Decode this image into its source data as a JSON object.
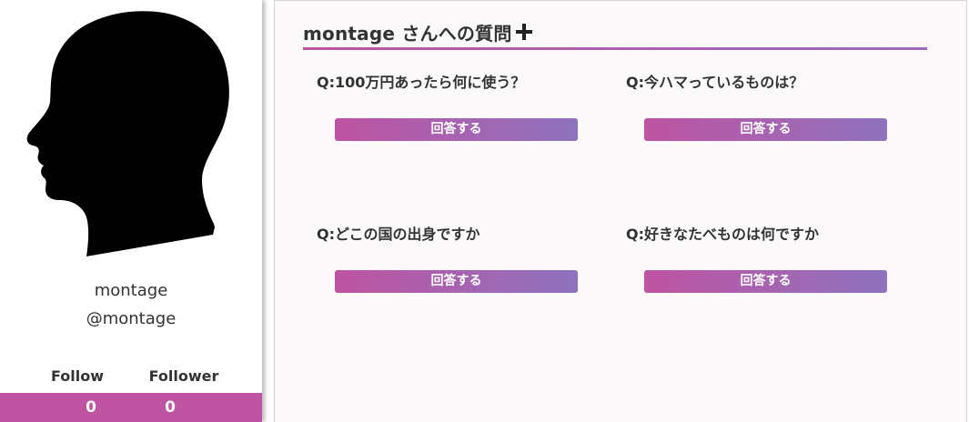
{
  "profile": {
    "name": "montage",
    "handle": "@montage",
    "follow_label": "Follow",
    "follower_label": "Follower",
    "follow_count": "0",
    "follower_count": "0",
    "accent_color": "#bf54a2"
  },
  "questions_panel": {
    "title": "montage さんへの質問",
    "add_icon": "plus-icon",
    "questions": [
      {
        "text": "Q:100万円あったら何に使う？",
        "button_label": "回答する"
      },
      {
        "text": "Q:今ハマっているものは？",
        "button_label": "回答する"
      },
      {
        "text": "Q:どこの国の出身ですか",
        "button_label": "回答する"
      },
      {
        "text": "Q:好きなたべものは何ですか",
        "button_label": "回答する"
      }
    ],
    "gradient_start": "#bf54a2",
    "gradient_end": "#8e72bd"
  }
}
